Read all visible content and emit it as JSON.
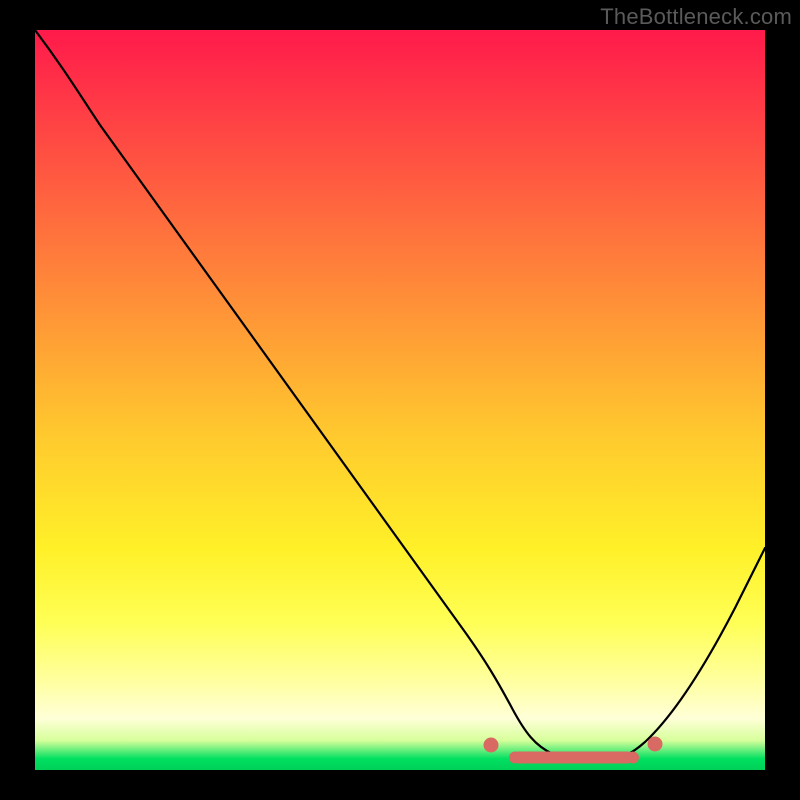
{
  "watermark": "TheBottleneck.com",
  "chart_data": {
    "type": "line",
    "title": "",
    "xlabel": "",
    "ylabel": "",
    "xlim": [
      0,
      100
    ],
    "ylim": [
      0,
      100
    ],
    "grid": false,
    "legend": false,
    "series": [
      {
        "name": "curve",
        "x": [
          0,
          5,
          10,
          20,
          30,
          40,
          50,
          57,
          62,
          66,
          70,
          74,
          77,
          80,
          84,
          88,
          92,
          96,
          100
        ],
        "y": [
          100,
          93,
          86,
          73,
          60,
          47,
          33,
          22,
          13,
          7,
          3,
          1.2,
          1,
          1.2,
          3,
          9,
          17,
          26,
          38
        ]
      }
    ],
    "markers": {
      "name": "highlight-band",
      "points": [
        {
          "x": 62,
          "y": 3.4
        },
        {
          "x": 66,
          "y": 2.8
        },
        {
          "x": 70,
          "y": 2.3
        },
        {
          "x": 73,
          "y": 2.1
        },
        {
          "x": 76,
          "y": 2.1
        },
        {
          "x": 79,
          "y": 2.3
        },
        {
          "x": 82,
          "y": 2.9
        },
        {
          "x": 85,
          "y": 3.6
        }
      ]
    },
    "background_gradient": {
      "top": "#ff1a4b",
      "mid": "#ffff55",
      "bottom": "#00d058"
    }
  }
}
